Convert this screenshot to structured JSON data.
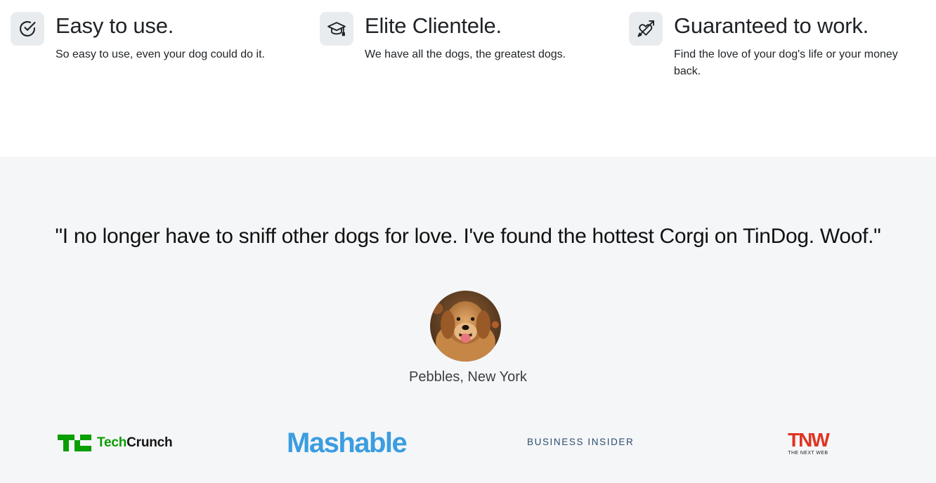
{
  "features": [
    {
      "icon": "check-circle-icon",
      "title": "Easy to use.",
      "text": "So easy to use, even your dog could do it."
    },
    {
      "icon": "graduation-cap-icon",
      "title": "Elite Clientele.",
      "text": "We have all the dogs, the greatest dogs."
    },
    {
      "icon": "heart-arrow-icon",
      "title": "Guaranteed to work.",
      "text": "Find the love of your dog's life or your money back."
    }
  ],
  "testimonial": {
    "quote": "\"I no longer have to sniff other dogs for love. I've found the hottest Corgi on TinDog. Woof.\"",
    "author": "Pebbles, New York"
  },
  "press": {
    "techcrunch": {
      "prefix": "Tech",
      "suffix": "Crunch"
    },
    "mashable": "Mashable",
    "business_insider": "BUSINESS INSIDER",
    "tnw": {
      "word": "TNW",
      "sub": "THE NEXT WEB"
    }
  },
  "colors": {
    "features_bg": "#ffffff",
    "testimonial_bg": "#f5f6f8",
    "techcrunch_green": "#0a9e01",
    "mashable_blue": "#3b9de0",
    "business_insider_navy": "#2d4c6e",
    "tnw_red": "#e03421"
  }
}
